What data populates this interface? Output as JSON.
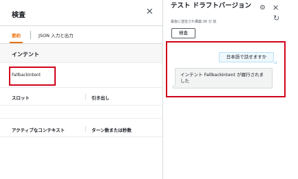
{
  "inspect_panel": {
    "title": "検査",
    "close_icon": "✕",
    "tabs": [
      {
        "label": "要約",
        "active": true
      },
      {
        "label": "JSON 入力と出力",
        "active": false
      }
    ],
    "intent_section": {
      "title": "インテント",
      "value": "FallbackIntent"
    },
    "slots_table": {
      "headers": [
        "スロット",
        "引き出し"
      ]
    },
    "context_table": {
      "headers": [
        "アクティブなコンテキスト",
        "ターン数または秒数"
      ]
    }
  },
  "test_panel": {
    "title": "テスト ドラフトバージョン",
    "subtitle": "最後に送信され構築:36 分 前",
    "gear_icon": "⚙",
    "close_icon": "✕",
    "refresh_icon": "↻",
    "inspect_button": "検査",
    "messages": [
      {
        "from": "user",
        "text": "日本語で話せますか"
      },
      {
        "from": "bot",
        "text": "インテント FallbackIntent が履行されました"
      }
    ]
  },
  "colors": {
    "accent": "#ec7211",
    "highlight": "#d0021b"
  }
}
